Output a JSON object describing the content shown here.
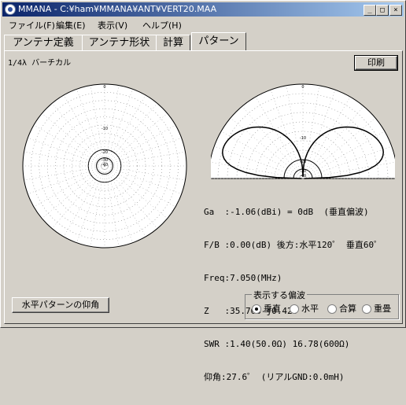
{
  "window": {
    "title": "MMANA - C:¥ham¥MMANA¥ANT¥VERT20.MAA",
    "min_glyph": "_",
    "max_glyph": "□",
    "close_glyph": "×"
  },
  "menu": [
    "ファイル(F)",
    "編集(E)",
    "表示(V)",
    "ヘルプ(H)"
  ],
  "tabs": [
    "アンテナ定義",
    "アンテナ形状",
    "計算",
    "パターン"
  ],
  "active_tab": 3,
  "panel": {
    "subtitle": "1/4λ バーチカル",
    "print_button": "印刷",
    "elevation_button": "水平パターンの仰角"
  },
  "plots": {
    "tick_labels": [
      "0",
      "-10",
      "-20",
      "-30",
      "-40"
    ]
  },
  "info": {
    "lines": [
      "Ga  :-1.06(dBi) = 0dB  (垂直偏波)",
      "F/B :0.00(dB) 後方:水平120゜ 垂直60゜",
      "Freq:7.050(MHz)",
      "Z   :35.766-j0.420",
      "SWR :1.40(50.0Ω) 16.78(600Ω)",
      "仰角:27.6゜ (リアルGND:0.0mH)"
    ]
  },
  "polarization": {
    "label": "表示する偏波",
    "options": [
      "垂直",
      "水平",
      "合算",
      "重畳"
    ],
    "selected": 0
  }
}
